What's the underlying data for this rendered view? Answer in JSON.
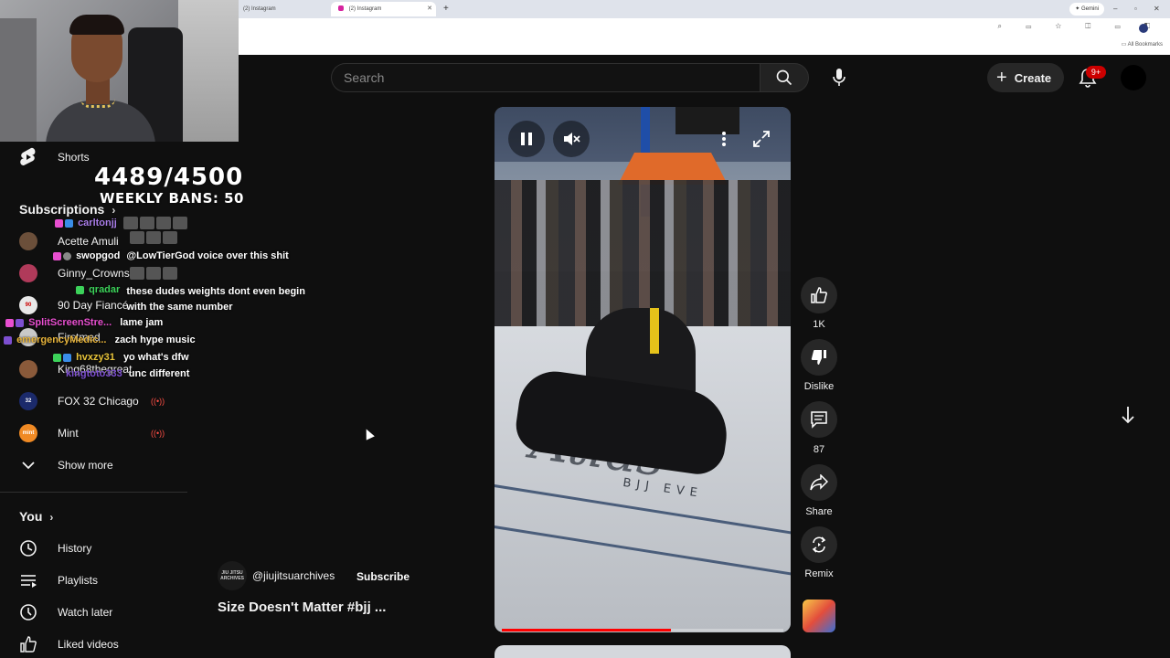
{
  "browser": {
    "tabs": [
      {
        "label": "(2) Instagram"
      },
      {
        "label": "(2) Instagram"
      }
    ],
    "new_tab_glyph": "+",
    "gemini_label": "Gemini",
    "bookmarks_label": "All Bookmarks"
  },
  "header": {
    "search_placeholder": "Search",
    "create_label": "Create",
    "notification_count": "9+"
  },
  "sidebar": {
    "shorts": "Shorts",
    "subscriptions_heading": "Subscriptions",
    "subscriptions": [
      {
        "label": "Acette Amuli",
        "avatar_color": "#6b4f3a"
      },
      {
        "label": "Ginny_Crowns",
        "avatar_color": "#b03a5a"
      },
      {
        "label": "90 Day Fiancé",
        "avatar_color": "#e8e8e8"
      },
      {
        "label": "Firstmed",
        "avatar_color": "#c9c9c9"
      },
      {
        "label": "King68thegreat",
        "avatar_color": "#8a5a3a"
      },
      {
        "label": "FOX 32 Chicago",
        "avatar_color": "#1b2a6b"
      },
      {
        "label": "Mint",
        "avatar_color": "#f08a24"
      }
    ],
    "show_more": "Show more",
    "you_heading": "You",
    "you_items": [
      {
        "label": "History",
        "icon": "history-icon"
      },
      {
        "label": "Playlists",
        "icon": "playlists-icon"
      },
      {
        "label": "Watch later",
        "icon": "watch-later-icon"
      },
      {
        "label": "Liked videos",
        "icon": "liked-videos-icon"
      }
    ]
  },
  "overlay": {
    "counter": "4489/4500",
    "weekly_bans": "WEEKLY BANS: 50",
    "chat": [
      {
        "user": "carltonjj",
        "user_color": "#a97de8",
        "message": ""
      },
      {
        "user": "swopgod",
        "user_color": "#ffffff",
        "message": "@LowTierGod voice over this shit"
      },
      {
        "user": "qradar",
        "user_color": "#3cd25a",
        "message": "these dudes weights dont even begin with the same number"
      },
      {
        "user": "SplitScreenStre...",
        "user_color": "#e84fd0",
        "message": "lame jam"
      },
      {
        "user": "emergencyMedic...",
        "user_color": "#e8b43a",
        "message": "zach hype music"
      },
      {
        "user": "hvxzy31",
        "user_color": "#e8c43a",
        "message": "yo what's dfw"
      },
      {
        "user": "kingtoto333",
        "user_color": "#7d4fd0",
        "message": "unc different"
      }
    ]
  },
  "video": {
    "progress_fraction": 0.6,
    "overlay_text": "Atlas",
    "overlay_subtext": "BJJ EVE"
  },
  "actions": {
    "likes": "1K",
    "dislike": "Dislike",
    "comments": "87",
    "share": "Share",
    "remix": "Remix"
  },
  "meta": {
    "channel_handle": "@jiujitsuarchives",
    "channel_avatar_text": "JIU JITSU ARCHIVES",
    "subscribe": "Subscribe",
    "title": "Size Doesn't Matter #bjj ..."
  },
  "colors": {
    "background": "#0f0f0f",
    "surface": "#272727",
    "accent_red": "#ff0000",
    "live_red": "#ff4e45"
  }
}
